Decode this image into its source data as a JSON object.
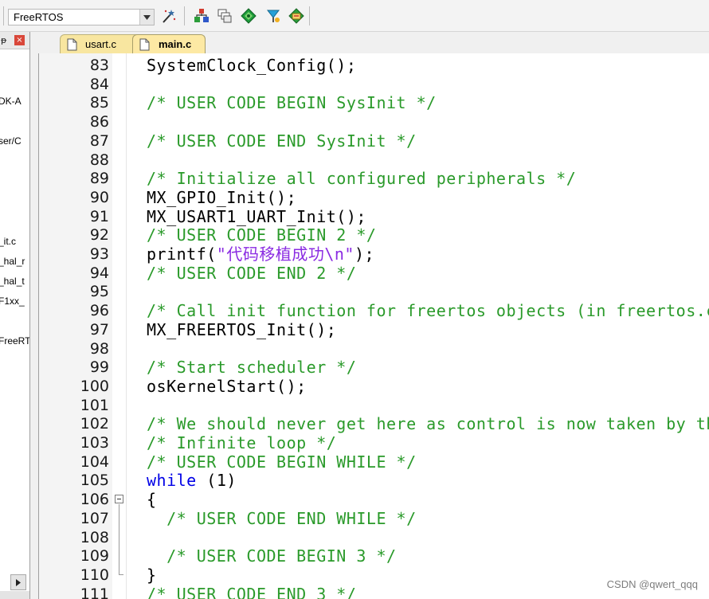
{
  "toolbar": {
    "target_name": "FreeRTOS",
    "icons": [
      "target-dropdown-icon",
      "options-for-target-icon",
      "manage-components-icon",
      "select-packs-icon",
      "pack-installer-icon",
      "rte-icon",
      "manage-run-time-environment-icon"
    ]
  },
  "project_pane": {
    "close_label": "×",
    "visible_fragments": [
      "DK-A",
      "ser/C",
      "_it.c",
      "_hal_r",
      "_hal_t",
      "F1xx_",
      "FreeRT"
    ]
  },
  "tabs": [
    {
      "label": "usart.c",
      "active": false
    },
    {
      "label": "main.c",
      "active": true
    }
  ],
  "editor": {
    "lines": [
      {
        "num": "83",
        "code": [
          {
            "t": "fn",
            "v": "SystemClock_Config();"
          }
        ]
      },
      {
        "num": "84",
        "code": []
      },
      {
        "num": "85",
        "code": [
          {
            "t": "comment",
            "v": "/* USER CODE BEGIN SysInit */"
          }
        ]
      },
      {
        "num": "86",
        "code": []
      },
      {
        "num": "87",
        "code": [
          {
            "t": "comment",
            "v": "/* USER CODE END SysInit */"
          }
        ]
      },
      {
        "num": "88",
        "code": []
      },
      {
        "num": "89",
        "code": [
          {
            "t": "comment",
            "v": "/* Initialize all configured peripherals */"
          }
        ]
      },
      {
        "num": "90",
        "code": [
          {
            "t": "fn",
            "v": "MX_GPIO_Init();"
          }
        ]
      },
      {
        "num": "91",
        "code": [
          {
            "t": "fn",
            "v": "MX_USART1_UART_Init();"
          }
        ]
      },
      {
        "num": "92",
        "code": [
          {
            "t": "comment",
            "v": "/* USER CODE BEGIN 2 */"
          }
        ]
      },
      {
        "num": "93",
        "code": [
          {
            "t": "fn",
            "v": "printf("
          },
          {
            "t": "str",
            "v": "\"代码移植成功\\n\""
          },
          {
            "t": "fn",
            "v": ");"
          }
        ]
      },
      {
        "num": "94",
        "code": [
          {
            "t": "comment",
            "v": "/* USER CODE END 2 */"
          }
        ]
      },
      {
        "num": "95",
        "code": []
      },
      {
        "num": "96",
        "code": [
          {
            "t": "comment",
            "v": "/* Call init function for freertos objects (in freertos.c"
          }
        ]
      },
      {
        "num": "97",
        "code": [
          {
            "t": "fn",
            "v": "MX_FREERTOS_Init();"
          }
        ]
      },
      {
        "num": "98",
        "code": []
      },
      {
        "num": "99",
        "code": [
          {
            "t": "comment",
            "v": "/* Start scheduler */"
          }
        ]
      },
      {
        "num": "100",
        "code": [
          {
            "t": "fn",
            "v": "osKernelStart();"
          }
        ]
      },
      {
        "num": "101",
        "code": []
      },
      {
        "num": "102",
        "code": [
          {
            "t": "comment",
            "v": "/* We should never get here as control is now taken by the"
          }
        ]
      },
      {
        "num": "103",
        "code": [
          {
            "t": "comment",
            "v": "/* Infinite loop */"
          }
        ]
      },
      {
        "num": "104",
        "code": [
          {
            "t": "comment",
            "v": "/* USER CODE BEGIN WHILE */"
          }
        ]
      },
      {
        "num": "105",
        "code": [
          {
            "t": "kw",
            "v": "while"
          },
          {
            "t": "fn",
            "v": " ("
          },
          {
            "t": "num",
            "v": "1"
          },
          {
            "t": "fn",
            "v": ")"
          }
        ]
      },
      {
        "num": "106",
        "code": [
          {
            "t": "fn",
            "v": "{"
          }
        ]
      },
      {
        "num": "107",
        "code": [
          {
            "t": "comment",
            "v": "  /* USER CODE END WHILE */"
          }
        ]
      },
      {
        "num": "108",
        "code": []
      },
      {
        "num": "109",
        "code": [
          {
            "t": "comment",
            "v": "  /* USER CODE BEGIN 3 */"
          }
        ]
      },
      {
        "num": "110",
        "code": [
          {
            "t": "fn",
            "v": "}"
          }
        ]
      },
      {
        "num": "111",
        "code": [
          {
            "t": "comment",
            "v": "/* USER CODE END 3 */"
          }
        ]
      }
    ]
  },
  "watermark": "CSDN @qwert_qqq",
  "colors": {
    "comment": "#2a9a2a",
    "keyword": "#0000e6",
    "string": "#8a2be2",
    "tab_active": "#fde9a4",
    "tab_inactive": "#f8e6a0"
  }
}
